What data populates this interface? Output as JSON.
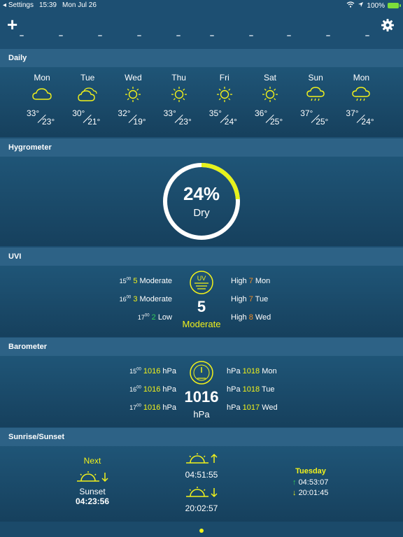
{
  "status_bar": {
    "back_app": "Settings",
    "time": "15:39",
    "date": "Mon Jul 26",
    "battery": "100%"
  },
  "sections": {
    "daily": "Daily",
    "hygrometer": "Hygrometer",
    "uvi": "UVI",
    "barometer": "Barometer",
    "sunrise_sunset": "Sunrise/Sunset"
  },
  "daily": [
    {
      "day": "Mon",
      "icon": "cloud-icon",
      "hi": "33°",
      "lo": "23°"
    },
    {
      "day": "Tue",
      "icon": "clouds-icon",
      "hi": "30°",
      "lo": "21°"
    },
    {
      "day": "Wed",
      "icon": "sun-icon",
      "hi": "32°",
      "lo": "19°"
    },
    {
      "day": "Thu",
      "icon": "sun-icon",
      "hi": "33°",
      "lo": "23°"
    },
    {
      "day": "Fri",
      "icon": "sun-icon",
      "hi": "35°",
      "lo": "24°"
    },
    {
      "day": "Sat",
      "icon": "sun-icon",
      "hi": "36°",
      "lo": "25°"
    },
    {
      "day": "Sun",
      "icon": "rain-cloud-icon",
      "hi": "37°",
      "lo": "25°"
    },
    {
      "day": "Mon",
      "icon": "rain-cloud-icon",
      "hi": "37°",
      "lo": "24°"
    }
  ],
  "hygrometer": {
    "value": "24%",
    "label": "Dry",
    "fraction": 0.24
  },
  "uvi": {
    "hourly": [
      {
        "hour": "15",
        "min": "00",
        "value": "5",
        "label": "Moderate"
      },
      {
        "hour": "16",
        "min": "00",
        "value": "3",
        "label": "Moderate"
      },
      {
        "hour": "17",
        "min": "00",
        "value": "2",
        "label": "Low"
      }
    ],
    "current_value": "5",
    "current_label": "Moderate",
    "icon_text": "UV",
    "daily": [
      {
        "label": "High",
        "value": "7",
        "day": "Mon"
      },
      {
        "label": "High",
        "value": "7",
        "day": "Tue"
      },
      {
        "label": "High",
        "value": "8",
        "day": "Wed"
      }
    ]
  },
  "barometer": {
    "hourly": [
      {
        "hour": "15",
        "min": "00",
        "value": "1016",
        "unit": "hPa"
      },
      {
        "hour": "16",
        "min": "00",
        "value": "1016",
        "unit": "hPa"
      },
      {
        "hour": "17",
        "min": "00",
        "value": "1016",
        "unit": "hPa"
      }
    ],
    "current_value": "1016",
    "current_unit": "hPa",
    "daily": [
      {
        "unit": "hPa",
        "value": "1018",
        "day": "Mon"
      },
      {
        "unit": "hPa",
        "value": "1018",
        "day": "Tue"
      },
      {
        "unit": "hPa",
        "value": "1017",
        "day": "Wed"
      }
    ]
  },
  "sun": {
    "next_label": "Next",
    "next_event": "Sunset",
    "next_time": "04:23:56",
    "sunrise": "04:51:55",
    "sunset": "20:02:57",
    "tomorrow_label": "Tuesday",
    "tomorrow_sunrise": "04:53:07",
    "tomorrow_sunset": "20:01:45"
  },
  "colors": {
    "accent": "#f2f21b",
    "background": "#1d4f72",
    "header": "#2d6286",
    "high_orange": "#f08a24",
    "green": "#35d05a"
  }
}
